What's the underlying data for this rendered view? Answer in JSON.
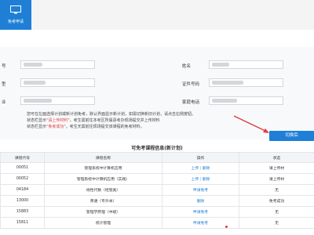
{
  "app": {
    "tile_label": "免考申请",
    "tile_icon": "monitor-icon",
    "brand_color": "#1f7fd6"
  },
  "form": {
    "labels": [
      "号",
      "姓名",
      "型",
      "证件号码",
      "业",
      "家庭电话"
    ],
    "input_values": [
      "",
      "",
      "",
      "",
      "",
      ""
    ]
  },
  "notice": {
    "line1": "您可在左面选择计划或新计划免考，默认界面显示新计划，如需切换新旧计划，请点击右侧按钮。",
    "line2_prefix": "状态栏显示",
    "line2_highlight": "\"请上传材料\"",
    "line2_suffix": "，考生需前往本考区所属县考办现场提交并上传材料",
    "line3_prefix": "状态栏显示",
    "line3_highlight": "\"免考成功\"",
    "line3_suffix": "，考生无需前往现场提交该课程的免考材料。"
  },
  "switch_button": {
    "label": "切换后",
    "color": "#1f7fd6"
  },
  "table": {
    "title": "可免考课程信息(新计划)",
    "headers": [
      "课程代号",
      "课程名称",
      "操作",
      "状态"
    ],
    "rows": [
      {
        "code": "00051",
        "name": "管理系统中计算机应用",
        "op_a": "上传",
        "op_sep": "|",
        "op_b": "删除",
        "status": "请上传材"
      },
      {
        "code": "00052",
        "name": "管理系统中计算机应用（实践）",
        "op_a": "上传",
        "op_sep": "|",
        "op_b": "删除",
        "status": "请上传材"
      },
      {
        "code": "04184",
        "name": "线性代数（经管类）",
        "op_a": "申请免考",
        "op_sep": "",
        "op_b": "",
        "status": "无"
      },
      {
        "code": "13000",
        "name": "英语（专升本）",
        "op_a": "删除",
        "op_sep": "",
        "op_b": "",
        "status": "免考成功"
      },
      {
        "code": "15883",
        "name": "管理学原理（中级）",
        "op_a": "申请免考",
        "op_sep": "",
        "op_b": "",
        "status": "无"
      },
      {
        "code": "15811",
        "name": "统计管理",
        "op_a": "申请免考",
        "op_sep": "",
        "op_b": "",
        "status": "无"
      }
    ]
  }
}
